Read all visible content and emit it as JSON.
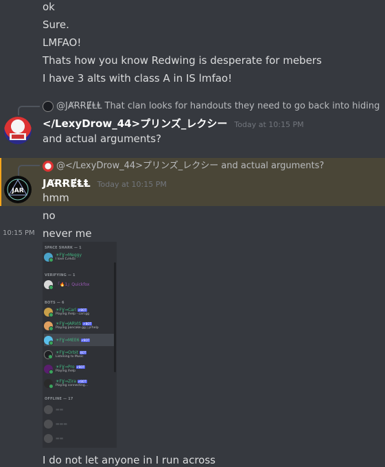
{
  "messages_top": [
    {
      "text": "ok"
    },
    {
      "text": "Sure."
    },
    {
      "text": "LMFAO!"
    },
    {
      "text": "Thats how you know Redwing is desperate for mebers"
    },
    {
      "text": "I have 3 alts with class A in IS lmfao!"
    }
  ],
  "msg_lexy": {
    "reply_author": "@JȺɌɌɆⱠⱠ",
    "reply_text": "That clan looks for handouts they need to go back into hiding",
    "author": "</LexyDrow_44>プリンズ_レクシー",
    "timestamp": "Today at 10:15 PM",
    "text": "and actual arguments?"
  },
  "msg_jarrell": {
    "reply_author": "@</LexyDrow_44>プリンズ_レクシー",
    "reply_text": "and actual arguments?",
    "author": "JȺɌɌɆⱠⱠ",
    "timestamp": "Today at 10:15 PM",
    "lines": [
      "hmm",
      "no",
      "never me"
    ],
    "hover_time": "10:15 PM",
    "last_line": "I do not let anyone in I run across"
  },
  "embedded_member_list": {
    "sections": [
      {
        "label": "SPACE SHARK — 1"
      },
      {
        "label": "VERIFYING — 1"
      },
      {
        "label": "BOTS — 6"
      },
      {
        "label": "OFFLINE — 17"
      }
    ],
    "members": [
      {
        "name": "☀FƔ⊸Meggy",
        "status": "I love C₂H₅O₂",
        "bot": "",
        "color": "#43b581"
      },
      {
        "name": "「🔥1」Quickfox",
        "status": "",
        "bot": "",
        "color": "#9b59b6"
      },
      {
        "name": "☀FƔ⊸Carl",
        "status": "Playing /help - carl.gg",
        "bot": "✔BOT",
        "color": "#43b581"
      },
      {
        "name": "☀FƔ⊸JARVIS",
        "status": "Playing pancake.gg | p!help",
        "bot": "✔BOT",
        "color": "#43b581"
      },
      {
        "name": "☀FƔ⊸MEE6",
        "status": "",
        "bot": "✔BOT",
        "color": "#43b581"
      },
      {
        "name": "☀FƔ⊸Orbit",
        "status": "Listening to Music",
        "bot": "BOT",
        "color": "#43b581"
      },
      {
        "name": "☀FƔ⊸Pro",
        "status": "Playing /help",
        "bot": "✔BOT",
        "color": "#43b581"
      },
      {
        "name": "☀FƔ⊸Zira",
        "status": "Playing connecting...",
        "bot": "✔BOT",
        "color": "#43b581"
      }
    ]
  },
  "colors": {
    "background": "#36393f",
    "highlight": "#4a4637",
    "mention_bar": "#faa61a",
    "text": "#dcddde",
    "timestamp": "#72767d"
  }
}
